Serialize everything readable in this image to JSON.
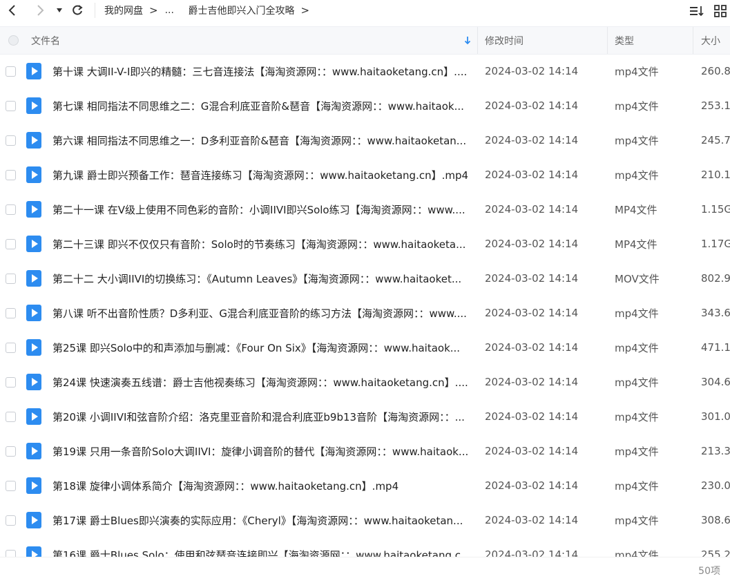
{
  "breadcrumb": {
    "items": [
      "我的网盘",
      "...",
      "爵士吉他即兴入门全攻略"
    ],
    "separator": ">"
  },
  "columns": {
    "name": "文件名",
    "modified": "修改时间",
    "type": "类型",
    "size": "大小"
  },
  "files": [
    {
      "name": "第十课 大调II-V-I即兴的精髓：三七音连接法【海淘资源网：：www.haitaoketang.cn】....",
      "modified": "2024-03-02 14:14",
      "type": "mp4文件",
      "size": "260.8"
    },
    {
      "name": "第七课 相同指法不同思维之二：G混合利底亚音阶&琶音【海淘资源网：：www.haitaok...",
      "modified": "2024-03-02 14:14",
      "type": "mp4文件",
      "size": "253.1"
    },
    {
      "name": "第六课 相同指法不同思维之一：D多利亚音阶&琶音【海淘资源网：：www.haitaoketan...",
      "modified": "2024-03-02 14:14",
      "type": "mp4文件",
      "size": "245.7"
    },
    {
      "name": "第九课 爵士即兴预备工作：琶音连接练习【海淘资源网：：www.haitaoketang.cn】.mp4",
      "modified": "2024-03-02 14:14",
      "type": "mp4文件",
      "size": "210.1"
    },
    {
      "name": "第二十一课 在V级上使用不同色彩的音阶：小调IIVI即兴Solo练习【海淘资源网：：www....",
      "modified": "2024-03-02 14:14",
      "type": "MP4文件",
      "size": "1.15G"
    },
    {
      "name": "第二十三课 即兴不仅仅只有音阶：Solo时的节奏练习【海淘资源网：：www.haitaoketa...",
      "modified": "2024-03-02 14:14",
      "type": "MP4文件",
      "size": "1.17G"
    },
    {
      "name": "第二十二 大小调IIVI的切换练习：《Autumn Leaves》【海淘资源网：：www.haitaoket...",
      "modified": "2024-03-02 14:14",
      "type": "MOV文件",
      "size": "802.9"
    },
    {
      "name": "第八课 听不出音阶性质？D多利亚、G混合利底亚音阶的练习方法【海淘资源网：：www....",
      "modified": "2024-03-02 14:14",
      "type": "mp4文件",
      "size": "343.6"
    },
    {
      "name": "第25课 即兴Solo中的和声添加与删减：《Four On Six》【海淘资源网：：www.haitaok...",
      "modified": "2024-03-02 14:14",
      "type": "mp4文件",
      "size": "471.1"
    },
    {
      "name": "第24课 快速演奏五线谱：爵士吉他视奏练习【海淘资源网：：www.haitaoketang.cn】....",
      "modified": "2024-03-02 14:14",
      "type": "mp4文件",
      "size": "304.6"
    },
    {
      "name": "第20课 小调IIVI和弦音阶介绍：洛克里亚音阶和混合利底亚b9b13音阶【海淘资源网：：...",
      "modified": "2024-03-02 14:14",
      "type": "mp4文件",
      "size": "301.0"
    },
    {
      "name": "第19课 只用一条音阶Solo大调IIVI：旋律小调音阶的替代【海淘资源网：：www.haitaok...",
      "modified": "2024-03-02 14:14",
      "type": "mp4文件",
      "size": "213.3"
    },
    {
      "name": "第18课 旋律小调体系简介【海淘资源网：：www.haitaoketang.cn】.mp4",
      "modified": "2024-03-02 14:14",
      "type": "mp4文件",
      "size": "230.0"
    },
    {
      "name": "第17课 爵士Blues即兴演奏的实际应用：《Cheryl》【海淘资源网：：www.haitaoketan...",
      "modified": "2024-03-02 14:14",
      "type": "mp4文件",
      "size": "308.6"
    },
    {
      "name": "第16课 爵士Blues Solo：使用和弦琶音连接即兴【海淘资源网：：www.haitaoketang.c...",
      "modified": "2024-03-02 14:14",
      "type": "mp4文件",
      "size": "255.2"
    }
  ],
  "footer": {
    "count": "50项"
  },
  "colors": {
    "accent": "#2d8cf0",
    "header_bg": "#f7f8fa"
  },
  "icons": {
    "back": "chevron-left-icon",
    "forward": "chevron-right-icon",
    "history": "caret-down-icon",
    "refresh": "refresh-icon",
    "sort": "sort-icon",
    "grid": "grid-view-icon",
    "file": "video-file-icon"
  }
}
